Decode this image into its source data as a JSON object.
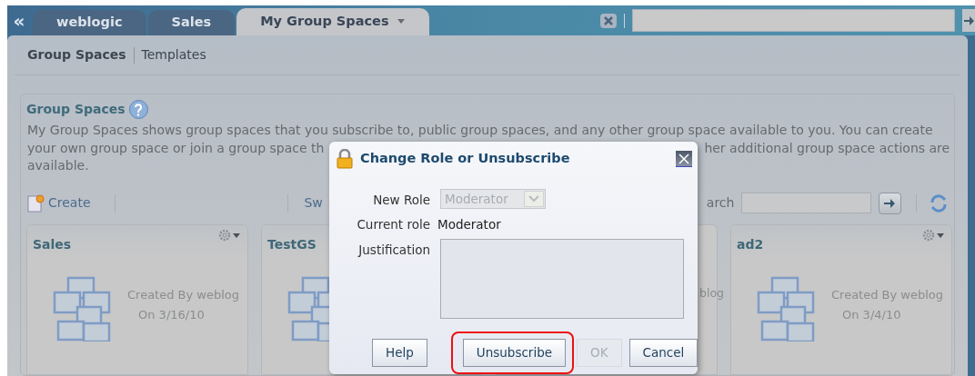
{
  "tabs_bar": {
    "collapse_icon": "«",
    "tabs": [
      {
        "label": "weblogic",
        "selected": false
      },
      {
        "label": "Sales",
        "selected": false
      },
      {
        "label": "My Group Spaces",
        "selected": true
      }
    ]
  },
  "subnav": [
    {
      "label": "Group Spaces",
      "selected": true
    },
    {
      "label": "Templates",
      "selected": false
    }
  ],
  "section": {
    "title": "Group Spaces",
    "description": [
      {
        "segments": [
          "My Group Spaces shows group spaces that you subscribe to, public group spaces, and any other group space available to you. You can create"
        ]
      },
      {
        "segments": [
          "your own group space or join a group space th",
          "her additional group space actions are"
        ]
      },
      {
        "segments": [
          "available."
        ]
      }
    ]
  },
  "toolbar": {
    "create": "Create",
    "partial_action": "Sw",
    "partial_search_label": "arch"
  },
  "cards": [
    {
      "kind": "full",
      "title": "Sales",
      "menu": true,
      "created_by": "Created By weblog",
      "date": "On 3/16/10"
    },
    {
      "kind": "full",
      "title": "TestGS"
    },
    {
      "kind": "covered",
      "fragment": "blog"
    },
    {
      "kind": "full",
      "title": "ad2",
      "menu": true,
      "created_by": "Created By weblog",
      "date": "On 3/4/10"
    }
  ],
  "dialog": {
    "title": "Change Role or Unsubscribe",
    "fields": [
      {
        "kind": "select",
        "label": "New Role",
        "value": "Moderator",
        "disabled": true
      },
      {
        "kind": "text",
        "label": "Current role",
        "value": "Moderator"
      },
      {
        "kind": "textarea",
        "label": "Justification"
      }
    ],
    "buttons": [
      {
        "label": "Help",
        "disabled": false,
        "highlighted": false
      },
      {
        "label": "Unsubscribe",
        "disabled": false,
        "highlighted": true
      },
      {
        "label": "OK",
        "disabled": true,
        "highlighted": false
      },
      {
        "label": "Cancel",
        "disabled": false,
        "highlighted": false
      }
    ]
  }
}
